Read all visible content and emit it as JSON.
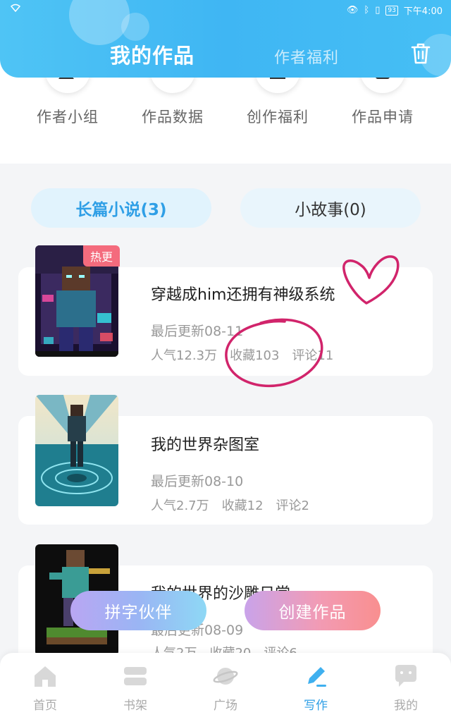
{
  "status_bar": {
    "time": "下午4:00",
    "battery": "93"
  },
  "header": {
    "active_tab": "我的作品",
    "inactive_tab": "作者福利",
    "trash_icon": "trash-icon"
  },
  "categories": [
    {
      "label": "作者小组",
      "icon": "group-icon"
    },
    {
      "label": "作品数据",
      "icon": "layers-icon"
    },
    {
      "label": "创作福利",
      "icon": "gift-icon"
    },
    {
      "label": "作品申请",
      "icon": "document-icon"
    }
  ],
  "tabs": [
    {
      "label": "长篇小说(3)",
      "active": true
    },
    {
      "label": "小故事(0)",
      "active": false
    }
  ],
  "works": [
    {
      "title": "穿越成him还拥有神级系统",
      "updated": "最后更新08-11",
      "popularity": "人气12.3万",
      "favorites": "收藏103",
      "comments": "评论11",
      "badge": "热更"
    },
    {
      "title": "我的世界杂图室",
      "updated": "最后更新08-10",
      "popularity": "人气2.7万",
      "favorites": "收藏12",
      "comments": "评论2"
    },
    {
      "title": "我的世界的沙雕日常",
      "updated": "最后更新08-09",
      "popularity": "人气2万",
      "favorites": "收藏20",
      "comments": "评论6"
    }
  ],
  "floating_buttons": {
    "partner": "拼字伙伴",
    "create": "创建作品"
  },
  "bottom_nav": [
    {
      "label": "首页",
      "icon": "home-icon",
      "active": false
    },
    {
      "label": "书架",
      "icon": "bookshelf-icon",
      "active": false
    },
    {
      "label": "广场",
      "icon": "planet-icon",
      "active": false
    },
    {
      "label": "写作",
      "icon": "pen-icon",
      "active": true
    },
    {
      "label": "我的",
      "icon": "chat-face-icon",
      "active": false
    }
  ],
  "colors": {
    "accent": "#2f9fe6",
    "header": "#3fb6f3",
    "hot_badge": "#f46b7d",
    "annotation": "#d1246b"
  }
}
